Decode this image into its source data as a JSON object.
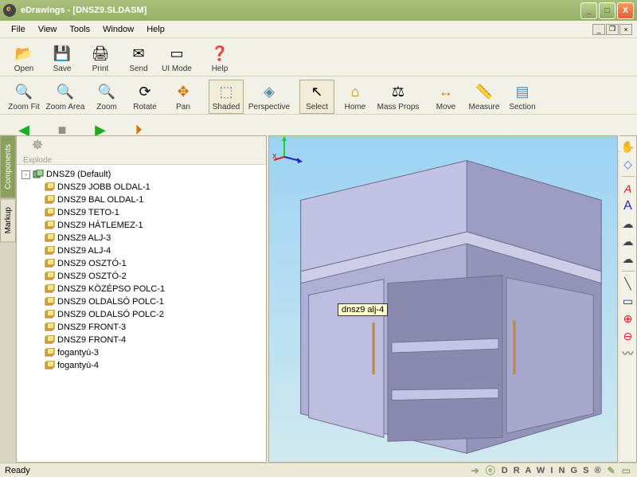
{
  "title": "eDrawings - [DNSZ9.SLDASM]",
  "menus": {
    "file": "File",
    "view": "View",
    "tools": "Tools",
    "window": "Window",
    "help": "Help"
  },
  "toolbar1": {
    "open": "Open",
    "save": "Save",
    "print": "Print",
    "send": "Send",
    "uimode": "UI Mode",
    "help": "Help"
  },
  "toolbar2": {
    "zoomfit": "Zoom Fit",
    "zoomarea": "Zoom Area",
    "zoom": "Zoom",
    "rotate": "Rotate",
    "pan": "Pan",
    "shaded": "Shaded",
    "perspective": "Perspective",
    "select": "Select",
    "home": "Home",
    "massprops": "Mass Props",
    "move": "Move",
    "measure": "Measure",
    "section": "Section"
  },
  "toolbar3": {
    "previous": "Previous",
    "stop": "Stop",
    "next": "Next",
    "play": "Play"
  },
  "sidetabs": {
    "components": "Components",
    "markup": "Markup"
  },
  "panel": {
    "explode": "Explode"
  },
  "tree": {
    "root": "DNSZ9 (Default)",
    "items": [
      "DNSZ9 JOBB OLDAL-1",
      "DNSZ9 BAL OLDAL-1",
      "DNSZ9 TETO-1",
      "DNSZ9 HÁTLEMEZ-1",
      "DNSZ9 ALJ-3",
      "DNSZ9 ALJ-4",
      "DNSZ9 OSZTÓ-1",
      "DNSZ9 OSZTÓ-2",
      "DNSZ9 KÖZÉPSO POLC-1",
      "DNSZ9 OLDALSÓ POLC-1",
      "DNSZ9 OLDALSÓ POLC-2",
      "DNSZ9 FRONT-3",
      "DNSZ9 FRONT-4",
      "fogantyú-3",
      "fogantyú-4"
    ]
  },
  "tooltip": "dnsz9 alj-4",
  "status": {
    "ready": "Ready",
    "brand": "D R A W I N G S ®"
  }
}
